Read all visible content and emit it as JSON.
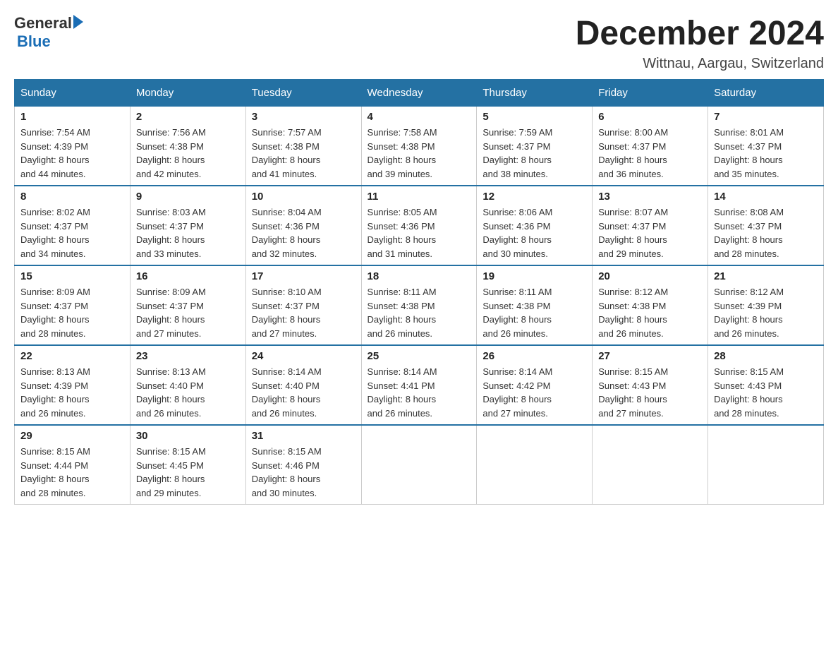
{
  "logo": {
    "general": "General",
    "blue": "Blue",
    "arrow": "▶"
  },
  "title": "December 2024",
  "location": "Wittnau, Aargau, Switzerland",
  "days_of_week": [
    "Sunday",
    "Monday",
    "Tuesday",
    "Wednesday",
    "Thursday",
    "Friday",
    "Saturday"
  ],
  "weeks": [
    [
      {
        "day": "1",
        "sunrise": "7:54 AM",
        "sunset": "4:39 PM",
        "daylight": "8 hours and 44 minutes."
      },
      {
        "day": "2",
        "sunrise": "7:56 AM",
        "sunset": "4:38 PM",
        "daylight": "8 hours and 42 minutes."
      },
      {
        "day": "3",
        "sunrise": "7:57 AM",
        "sunset": "4:38 PM",
        "daylight": "8 hours and 41 minutes."
      },
      {
        "day": "4",
        "sunrise": "7:58 AM",
        "sunset": "4:38 PM",
        "daylight": "8 hours and 39 minutes."
      },
      {
        "day": "5",
        "sunrise": "7:59 AM",
        "sunset": "4:37 PM",
        "daylight": "8 hours and 38 minutes."
      },
      {
        "day": "6",
        "sunrise": "8:00 AM",
        "sunset": "4:37 PM",
        "daylight": "8 hours and 36 minutes."
      },
      {
        "day": "7",
        "sunrise": "8:01 AM",
        "sunset": "4:37 PM",
        "daylight": "8 hours and 35 minutes."
      }
    ],
    [
      {
        "day": "8",
        "sunrise": "8:02 AM",
        "sunset": "4:37 PM",
        "daylight": "8 hours and 34 minutes."
      },
      {
        "day": "9",
        "sunrise": "8:03 AM",
        "sunset": "4:37 PM",
        "daylight": "8 hours and 33 minutes."
      },
      {
        "day": "10",
        "sunrise": "8:04 AM",
        "sunset": "4:36 PM",
        "daylight": "8 hours and 32 minutes."
      },
      {
        "day": "11",
        "sunrise": "8:05 AM",
        "sunset": "4:36 PM",
        "daylight": "8 hours and 31 minutes."
      },
      {
        "day": "12",
        "sunrise": "8:06 AM",
        "sunset": "4:36 PM",
        "daylight": "8 hours and 30 minutes."
      },
      {
        "day": "13",
        "sunrise": "8:07 AM",
        "sunset": "4:37 PM",
        "daylight": "8 hours and 29 minutes."
      },
      {
        "day": "14",
        "sunrise": "8:08 AM",
        "sunset": "4:37 PM",
        "daylight": "8 hours and 28 minutes."
      }
    ],
    [
      {
        "day": "15",
        "sunrise": "8:09 AM",
        "sunset": "4:37 PM",
        "daylight": "8 hours and 28 minutes."
      },
      {
        "day": "16",
        "sunrise": "8:09 AM",
        "sunset": "4:37 PM",
        "daylight": "8 hours and 27 minutes."
      },
      {
        "day": "17",
        "sunrise": "8:10 AM",
        "sunset": "4:37 PM",
        "daylight": "8 hours and 27 minutes."
      },
      {
        "day": "18",
        "sunrise": "8:11 AM",
        "sunset": "4:38 PM",
        "daylight": "8 hours and 26 minutes."
      },
      {
        "day": "19",
        "sunrise": "8:11 AM",
        "sunset": "4:38 PM",
        "daylight": "8 hours and 26 minutes."
      },
      {
        "day": "20",
        "sunrise": "8:12 AM",
        "sunset": "4:38 PM",
        "daylight": "8 hours and 26 minutes."
      },
      {
        "day": "21",
        "sunrise": "8:12 AM",
        "sunset": "4:39 PM",
        "daylight": "8 hours and 26 minutes."
      }
    ],
    [
      {
        "day": "22",
        "sunrise": "8:13 AM",
        "sunset": "4:39 PM",
        "daylight": "8 hours and 26 minutes."
      },
      {
        "day": "23",
        "sunrise": "8:13 AM",
        "sunset": "4:40 PM",
        "daylight": "8 hours and 26 minutes."
      },
      {
        "day": "24",
        "sunrise": "8:14 AM",
        "sunset": "4:40 PM",
        "daylight": "8 hours and 26 minutes."
      },
      {
        "day": "25",
        "sunrise": "8:14 AM",
        "sunset": "4:41 PM",
        "daylight": "8 hours and 26 minutes."
      },
      {
        "day": "26",
        "sunrise": "8:14 AM",
        "sunset": "4:42 PM",
        "daylight": "8 hours and 27 minutes."
      },
      {
        "day": "27",
        "sunrise": "8:15 AM",
        "sunset": "4:43 PM",
        "daylight": "8 hours and 27 minutes."
      },
      {
        "day": "28",
        "sunrise": "8:15 AM",
        "sunset": "4:43 PM",
        "daylight": "8 hours and 28 minutes."
      }
    ],
    [
      {
        "day": "29",
        "sunrise": "8:15 AM",
        "sunset": "4:44 PM",
        "daylight": "8 hours and 28 minutes."
      },
      {
        "day": "30",
        "sunrise": "8:15 AM",
        "sunset": "4:45 PM",
        "daylight": "8 hours and 29 minutes."
      },
      {
        "day": "31",
        "sunrise": "8:15 AM",
        "sunset": "4:46 PM",
        "daylight": "8 hours and 30 minutes."
      },
      null,
      null,
      null,
      null
    ]
  ],
  "labels": {
    "sunrise": "Sunrise:",
    "sunset": "Sunset:",
    "daylight": "Daylight:"
  }
}
